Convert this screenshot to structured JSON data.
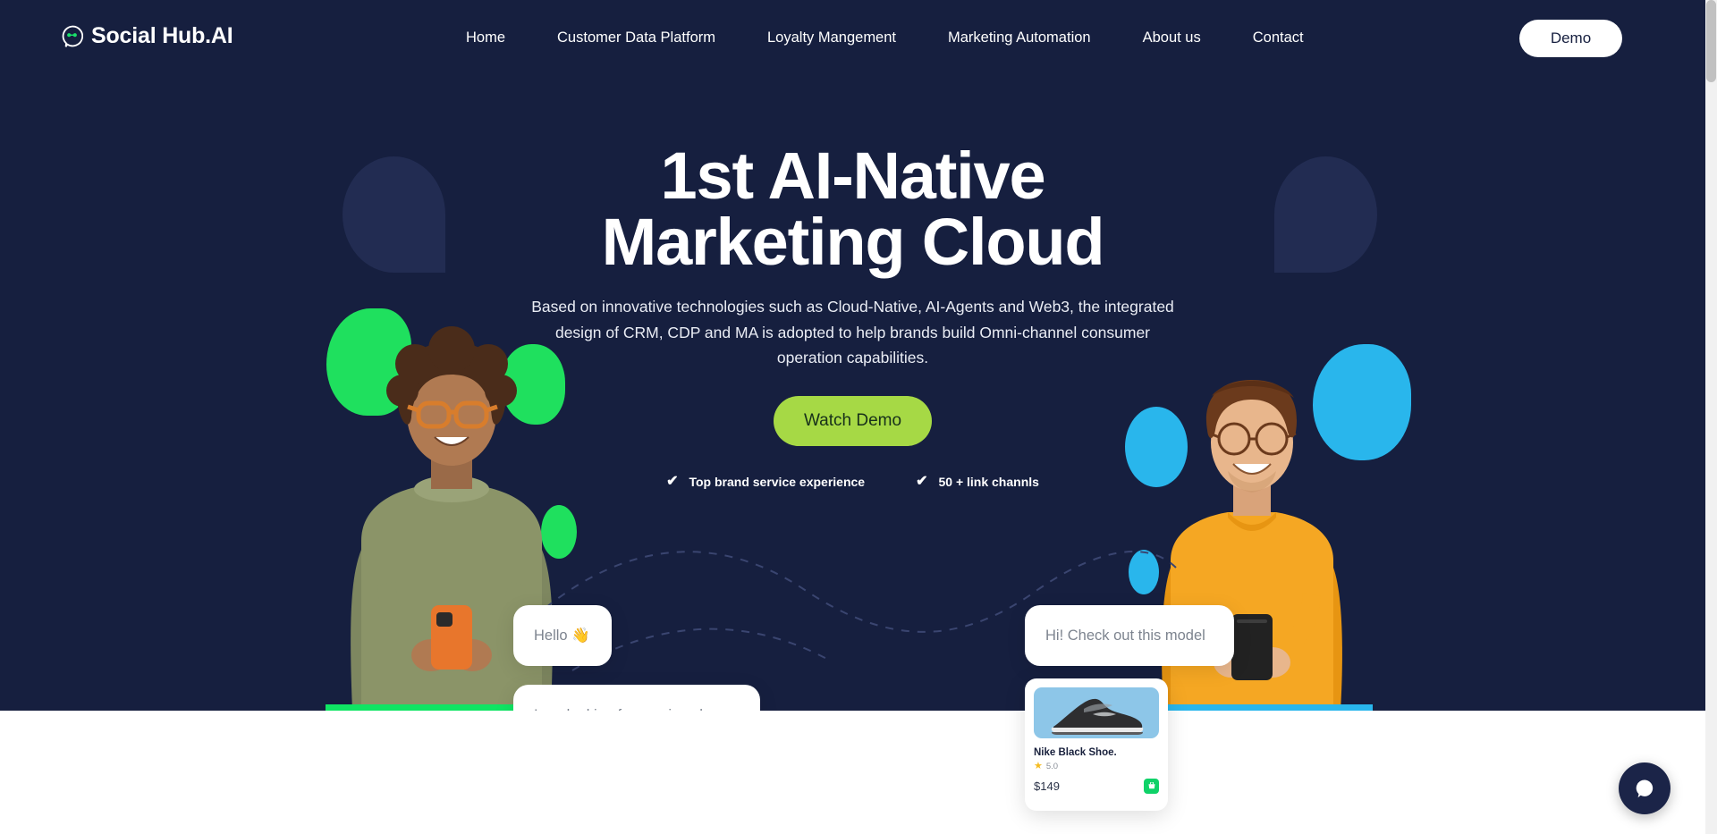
{
  "brand": {
    "name": "Social Hub.AI",
    "logo_icon": "chat-bubble-robot-icon",
    "navy": "#161f3f",
    "green": "#a6d945",
    "accent_green": "#0fe563",
    "accent_blue": "#29b6ec"
  },
  "nav": {
    "links": [
      {
        "label": "Home"
      },
      {
        "label": "Customer Data Platform"
      },
      {
        "label": "Loyalty Mangement"
      },
      {
        "label": "Marketing Automation"
      },
      {
        "label": "About us"
      },
      {
        "label": "Contact"
      }
    ],
    "demo_button": "Demo"
  },
  "hero": {
    "title_line1": "1st AI-Native",
    "title_line2": "Marketing Cloud",
    "subtitle": "Based on innovative technologies such as Cloud-Native, AI-Agents and Web3, the integrated design of CRM, CDP and MA is adopted to help brands build Omni-channel consumer operation capabilities.",
    "cta": "Watch Demo",
    "features": [
      {
        "icon": "check-icon",
        "label": "Top brand service experience"
      },
      {
        "icon": "check-icon",
        "label": "50 + link channls"
      }
    ]
  },
  "chat": {
    "bubbles": [
      {
        "id": "hello",
        "text": "Hello 👋"
      },
      {
        "id": "shoes",
        "text": "I am looking for running shoes"
      },
      {
        "id": "model",
        "text": "Hi! Check out this model"
      }
    ]
  },
  "product": {
    "image_alt": "nike-black-shoe-image",
    "name": "Nike Black Shoe.",
    "star_icon": "star-icon",
    "rating": "5.0",
    "price": "$149",
    "cart_icon": "shopping-cart-icon"
  },
  "widget": {
    "chat_icon": "chat-bubble-icon"
  }
}
